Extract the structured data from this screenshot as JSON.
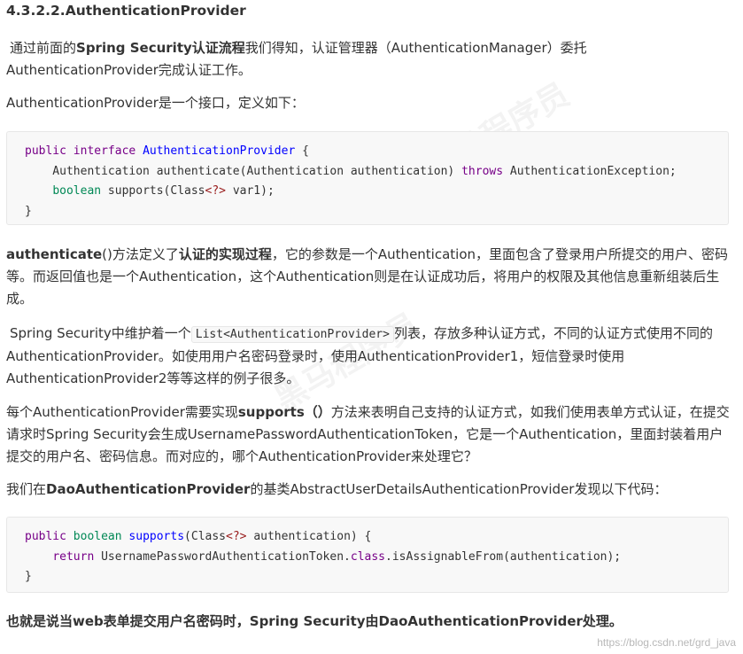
{
  "heading": "4.3.2.2.AuthenticationProvider",
  "p1": {
    "a": "通过前面的",
    "b": "Spring Security认证流程",
    "c": "我们得知，认证管理器（AuthenticationManager）委托AuthenticationProvider完成认证工作。"
  },
  "p2": "AuthenticationProvider是一个接口，定义如下：",
  "code1": {
    "line1_kw1": "public",
    "line1_kw2": "interface",
    "line1_def": "AuthenticationProvider",
    "line1_end": " {",
    "line2_a": "    Authentication authenticate(Authentication authentication) ",
    "line2_kw": "throws",
    "line2_b": " AuthenticationException;",
    "line3_kw": "boolean",
    "line3_a": " supports(Class",
    "line3_op": "<?>",
    "line3_b": " var1);",
    "line4": "}"
  },
  "p3": {
    "b1": "authenticate",
    "a": "()方法定义了",
    "b2": "认证的实现过程",
    "c": "，它的参数是一个Authentication，里面包含了登录用户所提交的用户、密码等。而返回值也是一个Authentication，这个Authentication则是在认证成功后，将用户的权限及其他信息重新组装后生成。"
  },
  "p4": {
    "a": "Spring Security中维护着一个",
    "code": "List<AuthenticationProvider>",
    "b": "列表，存放多种认证方式，不同的认证方式使用不同的AuthenticationProvider。如使用用户名密码登录时，使用AuthenticationProvider1，短信登录时使用AuthenticationProvider2等等这样的例子很多。"
  },
  "p5": {
    "a": "每个AuthenticationProvider需要实现",
    "b": "supports（）",
    "c": "方法来表明自己支持的认证方式，如我们使用表单方式认证，在提交请求时Spring Security会生成UsernamePasswordAuthenticationToken，它是一个Authentication，里面封装着用户提交的用户名、密码信息。而对应的，哪个AuthenticationProvider来处理它？"
  },
  "p6": {
    "a": "我们在",
    "b": "DaoAuthenticationProvider",
    "c": "的基类AbstractUserDetailsAuthenticationProvider发现以下代码："
  },
  "code2": {
    "line1_kw1": "public",
    "line1_kw2": "boolean",
    "line1_def": "supports",
    "line1_a": "(Class",
    "line1_op": "<?>",
    "line1_b": " authentication) {",
    "line2_kw": "return",
    "line2_a": " UsernamePasswordAuthenticationToken.",
    "line2_kw2": "class",
    "line2_b": ".isAssignableFrom(authentication);",
    "line3": "}"
  },
  "p7": "也就是说当web表单提交用户名密码时，Spring Security由DaoAuthenticationProvider处理。",
  "footer_url": "https://blog.csdn.net/grd_java",
  "watermark": "黑马程序员"
}
